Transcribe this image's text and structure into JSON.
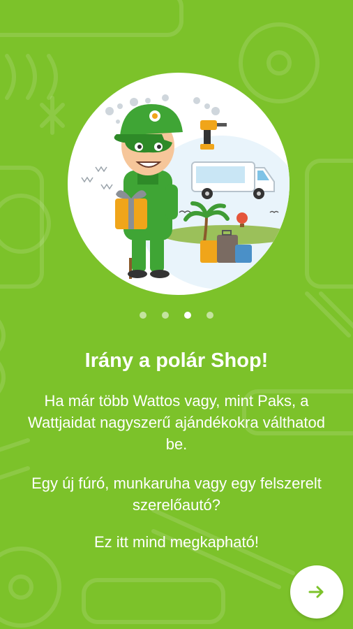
{
  "onboarding": {
    "title": "Irány a polár Shop!",
    "paragraphs": [
      "Ha már több Wattos vagy, mint Paks, a Wattjaidat nagyszerű ajándékokra válthatod be.",
      "Egy új fúró, munkaruha vagy egy felszerelt szerelőautó?",
      "Ez itt mind megkapható!"
    ],
    "pager": {
      "total": 4,
      "active_index": 3
    },
    "next_button_icon": "arrow-right-icon"
  },
  "colors": {
    "background": "#7cc22a",
    "text": "#ffffff",
    "accent": "#7cc22a",
    "dot_inactive": "rgba(255,255,255,0.55)"
  }
}
